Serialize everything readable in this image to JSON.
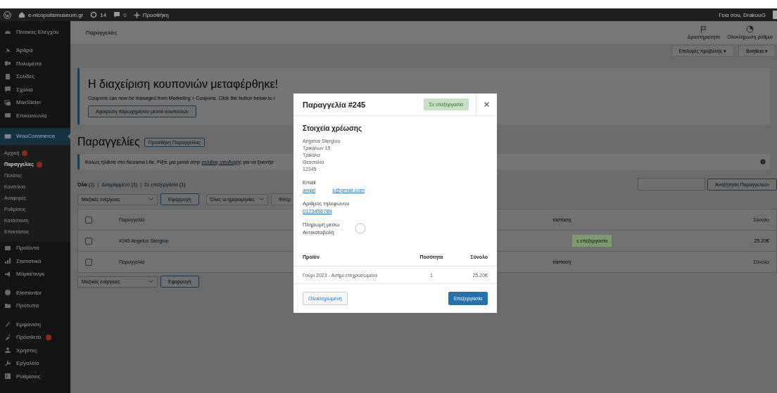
{
  "admin_bar": {
    "site": "e-nicopolismuseum.gr",
    "updates": "14",
    "comments": "0",
    "new": "Προσθήκη",
    "greeting": "Γεια σου, DrakouG"
  },
  "sidebar": {
    "groups": [
      {
        "items": [
          {
            "label": "Πίνακας Ελέγχου",
            "selected": false,
            "badge": false
          }
        ]
      },
      {
        "items": [
          {
            "label": "Άρθρα",
            "selected": false,
            "badge": false
          },
          {
            "label": "Πολυμέσα",
            "selected": false,
            "badge": false
          },
          {
            "label": "Σελίδες",
            "selected": false,
            "badge": false
          },
          {
            "label": "Σχόλια",
            "selected": false,
            "badge": false
          },
          {
            "label": "MaxSlider",
            "selected": false,
            "badge": false
          },
          {
            "label": "Επικοινωνία",
            "selected": false,
            "badge": false
          }
        ]
      },
      {
        "items": [
          {
            "label": "WooCommerce",
            "selected": true,
            "badge": false,
            "children": [
              {
                "label": "Αρχική",
                "selected": false,
                "badge": true
              },
              {
                "label": "Παραγγελίες",
                "selected": true,
                "badge": true
              },
              {
                "label": "Πελάτες",
                "selected": false,
                "badge": false
              },
              {
                "label": "Κουπόνια",
                "selected": false,
                "badge": false
              },
              {
                "label": "Αναφορές",
                "selected": false,
                "badge": false
              },
              {
                "label": "Ρυθμίσεις",
                "selected": false,
                "badge": false
              },
              {
                "label": "Κατάσταση",
                "selected": false,
                "badge": false
              },
              {
                "label": "Επεκτάσεις",
                "selected": false,
                "badge": false
              }
            ]
          },
          {
            "label": "Προϊόντα",
            "selected": false,
            "badge": false
          },
          {
            "label": "Στατιστικά",
            "selected": false,
            "badge": false
          },
          {
            "label": "Μάρκετινγκ",
            "selected": false,
            "badge": false
          }
        ]
      },
      {
        "items": [
          {
            "label": "Elementor",
            "selected": false,
            "badge": false
          },
          {
            "label": "Πρότυπα",
            "selected": false,
            "badge": false
          }
        ]
      },
      {
        "items": [
          {
            "label": "Εμφάνιση",
            "selected": false,
            "badge": false
          },
          {
            "label": "Πρόσθετα",
            "selected": false,
            "badge": true
          },
          {
            "label": "Χρήστες",
            "selected": false,
            "badge": false
          },
          {
            "label": "Εργαλεία",
            "selected": false,
            "badge": false
          },
          {
            "label": "Ρυθμίσεις",
            "selected": false,
            "badge": false
          }
        ]
      }
    ]
  },
  "header": {
    "title": "Παραγγελίες",
    "actions": [
      "Δραστηριότητα",
      "Ολοκλήρωση ρύθμισ"
    ],
    "tabs": [
      "Επιλογές προβολής ▾",
      "Βοήθεια ▾"
    ]
  },
  "coupon_notice": {
    "heading": "Η διαχείριση κουπονιών μεταφέρθηκε!",
    "text": "Coupons can now be managed from Marketing > Coupons. Click the button below to r",
    "button": "Αφαίρεση παρωχημένου μενού κουπονιών"
  },
  "page": {
    "title": "Παραγγελίες",
    "add_button": "Προσθήκη Παραγγελίας"
  },
  "welcome_notice": {
    "before": "Καλώς ήλθατε στο Nozama Lite. Ρίξτε μια ματιά στην",
    "link": "σελίδας υποδοχής",
    "after": "για να ξεκινήσ"
  },
  "views": [
    {
      "label": "Όλα",
      "count": "(1)",
      "selected": true
    },
    {
      "separator": "|",
      "label": "Διαγραμμένο",
      "count": "(1)",
      "selected": false
    },
    {
      "separator": "|",
      "label": "Σε επεξεργασία",
      "count": "(1)",
      "selected": false
    }
  ],
  "search": {
    "button": "Αναζήτηση Παραγγελιών"
  },
  "filters": {
    "bulk": "Μαζικές ενέργειες",
    "apply": "Εφαρμογή",
    "dates": "Όλες οι ημερομηνίες",
    "filter": "Φίλτρ"
  },
  "table": {
    "header_checked": false,
    "footer_checked": false,
    "columns": [
      "Παραγγελία",
      "τάσταση",
      "Σύνολο"
    ],
    "rows": [
      {
        "order": "#245 Angelos Stergiou",
        "status": "ε επεξεργασία",
        "total": "25.20€",
        "checked": false
      }
    ],
    "footer": [
      "Παραγγελία",
      "τάσταση",
      "Σύνολο"
    ]
  },
  "bottom_actions": {
    "bulk": "Μαζικές ενέργειες",
    "apply": "Εφαρμογή"
  },
  "modal": {
    "title": "Παραγγελία #245",
    "status": "Σε επεξεργασία",
    "billing_heading": "Στοιχεία χρέωσης",
    "address": [
      "Angelos Stergiou",
      "Τρικάλων 15",
      "Τρίκαλα",
      "Θεσσαλία",
      "12345"
    ],
    "email_label": "Email",
    "email": [
      "angel",
      "s@gmail.com"
    ],
    "phone_label": "Αριθμός τηλεφώνου",
    "phone": "0123456789",
    "payment": [
      "Πληρωμή μέσω",
      "Αντικαταβολή"
    ],
    "columns": [
      "Προϊόν",
      "Ποσότητα",
      "Σύνολο"
    ],
    "items": [
      {
        "product": "Γούρι 2023 - Ασήμι επιχρυσωμένο",
        "quantity": "1",
        "total": "25.20€"
      }
    ],
    "buttons": [
      {
        "label": "Ολοκληρωμένη",
        "kind": "secondary"
      },
      {
        "label": "Επεξεργασία",
        "kind": "primary"
      }
    ]
  }
}
